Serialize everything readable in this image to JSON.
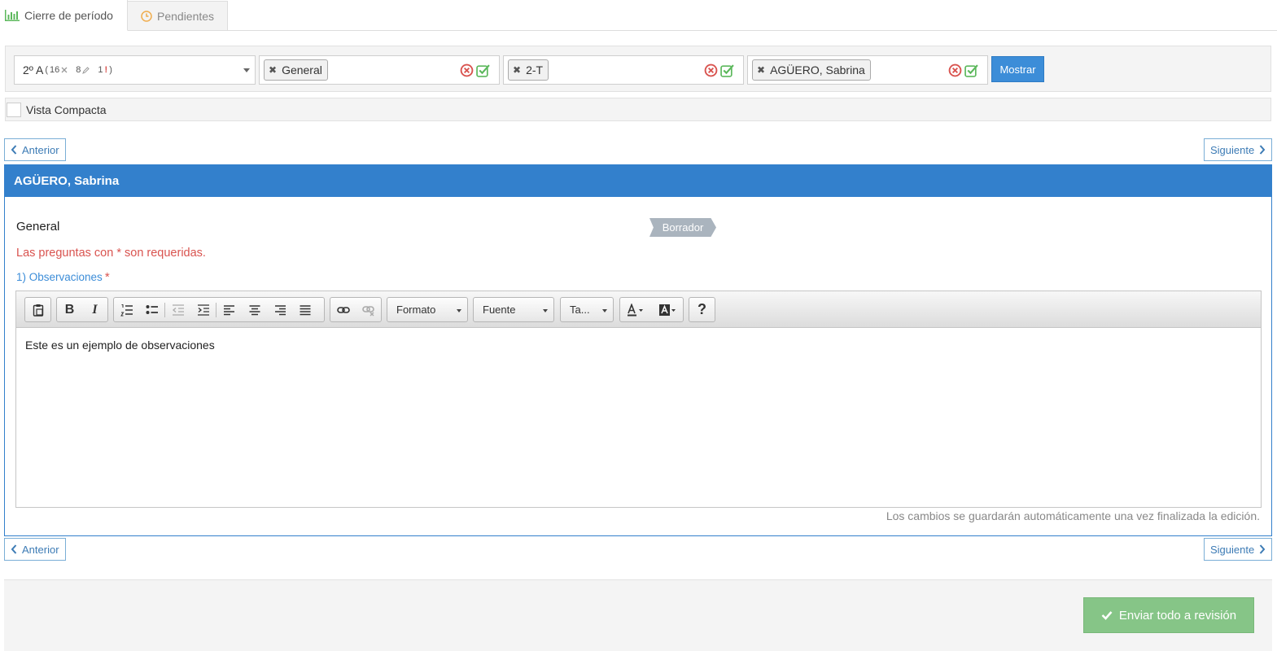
{
  "tabs": [
    {
      "label": "Cierre de período",
      "icon": "bar-chart-icon",
      "active": true
    },
    {
      "label": "Pendientes",
      "icon": "clock-icon",
      "active": false
    }
  ],
  "filters": {
    "course": {
      "label": "2º A",
      "count_a": "16",
      "count_b": "8",
      "count_c": "1",
      "open_paren": "(",
      "close_paren": ")"
    },
    "chips": [
      {
        "label": "General"
      },
      {
        "label": "2-T"
      },
      {
        "label": "AGÜERO, Sabrina"
      }
    ],
    "show_button": "Mostrar"
  },
  "compact_view": {
    "label": "Vista Compacta",
    "checked": false
  },
  "nav": {
    "prev": "Anterior",
    "next": "Siguiente"
  },
  "student": {
    "name": "AGÜERO, Sabrina",
    "section": "General",
    "status": "Borrador",
    "required_note": "Las preguntas con * son requeridas.",
    "question": {
      "label": "1) Observaciones",
      "required_mark": "*"
    },
    "editor": {
      "content": "Este es un ejemplo de observaciones",
      "format_label": "Formato",
      "font_label": "Fuente",
      "size_label": "Ta..."
    },
    "autosave_note": "Los cambios se guardarán automáticamente una vez finalizada la edición."
  },
  "footer": {
    "send_button": "Enviar todo a revisión"
  },
  "colors": {
    "primary": "#3380cc",
    "button": "#3c8dd8",
    "success": "#86c587",
    "danger": "#d9534f",
    "status": "#aab4be"
  }
}
